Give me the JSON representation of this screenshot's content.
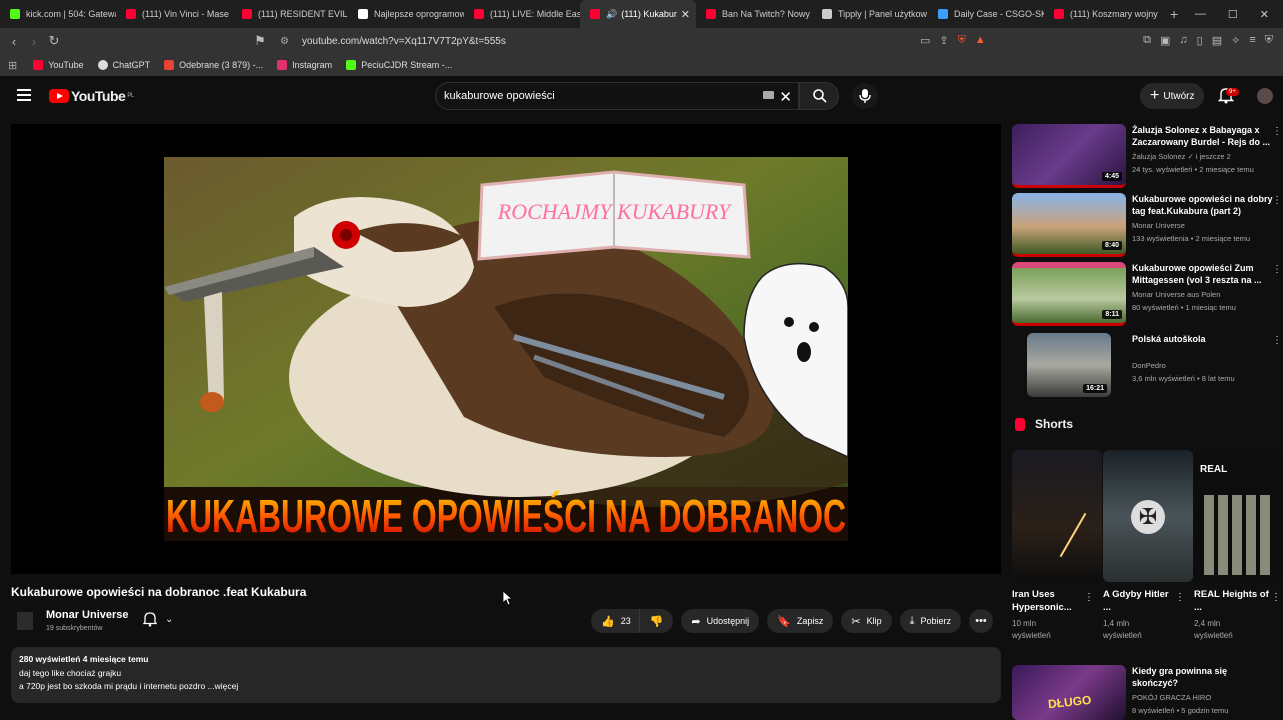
{
  "browser": {
    "tabs": [
      {
        "label": "kick.com | 504: Gatewa",
        "color": "#53fc18"
      },
      {
        "label": "(111) Vin Vinci - Mase",
        "color": "#ff0033"
      },
      {
        "label": "(111) RESIDENT EVIL 9",
        "color": "#ff0033"
      },
      {
        "label": "Najlepsze oprogramow",
        "color": "#ffffff"
      },
      {
        "label": "(111) LIVE: Middle Eas",
        "color": "#ff0033"
      },
      {
        "label": "(111) Kukabur",
        "color": "#ff0033"
      },
      {
        "label": "Ban Na Twitch? Nowy",
        "color": "#ff0033"
      },
      {
        "label": "Tipply | Panel użytkow",
        "color": "#cccccc"
      },
      {
        "label": "Daily Case - CSGO-SK",
        "color": "#3aa0ff"
      },
      {
        "label": "(111) Koszmary wojny",
        "color": "#ff0033"
      }
    ],
    "url": "youtube.com/watch?v=Xq117V7T2pY&t=555s",
    "bookmarks": [
      {
        "label": "YouTube",
        "color": "#ff0033"
      },
      {
        "label": "ChatGPT",
        "color": "#dddddd"
      },
      {
        "label": "Odebrane (3 879) -...",
        "color": "#ea4335"
      },
      {
        "label": "Instagram",
        "color": "#e1306c"
      },
      {
        "label": "PeciuCJDR Stream -...",
        "color": "#53fc18"
      }
    ]
  },
  "youtube": {
    "logo_text": "YouTube",
    "logo_region": "PL",
    "search_value": "kukaburowe opowieści",
    "create_label": "Utwórz",
    "notif_count": "9+"
  },
  "video": {
    "thumb_banner_top": "ROCHAJMY KUKABURY",
    "thumb_banner_bottom": "KUKABUROWE OPOWIEŚCI NA DOBRANOC",
    "title": "Kukaburowe opowieści na dobranoc .feat Kukabura",
    "channel": "Monar Universe",
    "subs": "19 subskrybentów",
    "likes": "23",
    "share_label": "Udostępnij",
    "save_label": "Zapisz",
    "clip_label": "Klip",
    "download_label": "Pobierz",
    "desc_meta": "280 wyświetleń  4 miesiące temu",
    "desc_line1": "daj tego like chociaż grajku",
    "desc_line2": "a 720p jest bo szkoda mi prądu i internetu pozdro ...więcej"
  },
  "sidebar": {
    "videos": [
      {
        "title": "Żaluzja Solonez x Babayaga x Zaczarowany Burdel - Rejs do ...",
        "channel": "Żaluzja Solonez ✓ i jeszcze 2",
        "meta": "24 tys. wyświetleń • 2 miesiące temu",
        "duration": "4:45"
      },
      {
        "title": "Kukaburowe opowieści na dobry tag feat.Kukabura (part 2)",
        "channel": "Monar Universe",
        "meta": "133 wyświetlenia • 2 miesiące temu",
        "duration": "8:40"
      },
      {
        "title": "Kukaburowe opowieści Zum Mittagessen (vol 3 reszta na ...",
        "channel": "Monar Universe aus Polen",
        "meta": "80 wyświetleń • 1 miesiąc temu",
        "duration": "8:11"
      },
      {
        "title": "Polská autoškola",
        "channel": "DonPedro",
        "meta": "3,6 mln wyświetleń • 8 lat temu",
        "duration": "16:21"
      }
    ],
    "shorts_label": "Shorts",
    "shorts": [
      {
        "title": "Iran Uses Hypersonic...",
        "views_line1": "10 mln",
        "views_line2": "wyświetleń"
      },
      {
        "title": "A Gdyby Hitler ...",
        "views_line1": "1,4 mln",
        "views_line2": "wyświetleń"
      },
      {
        "title": "REAL Heights of ...",
        "views_line1": "2,4 mln",
        "views_line2": "wyświetleń",
        "overlay": "REAL"
      }
    ],
    "last_video": {
      "title": "Kiedy gra powinna się skończyć?",
      "channel": "POKÓJ GRACZA HIRO",
      "meta": "8 wyświetleń • 5 godzin temu",
      "overlay": "DŁUGO"
    }
  }
}
